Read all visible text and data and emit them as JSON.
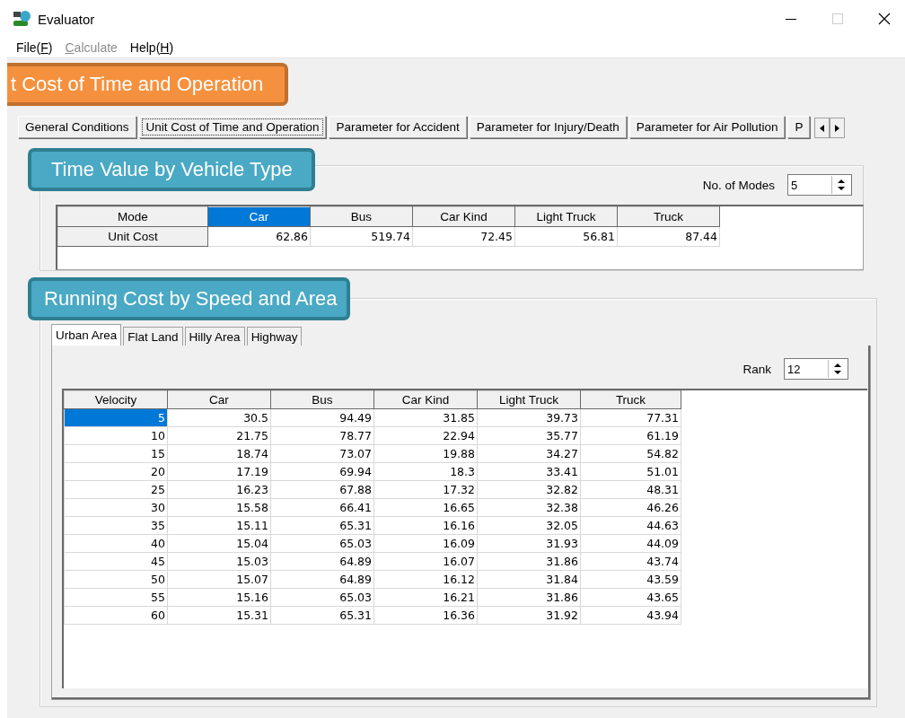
{
  "window": {
    "title": "Evaluator"
  },
  "menu": [
    {
      "before": "File(",
      "key": "F",
      "after": ")",
      "disabled": false
    },
    {
      "key": "C",
      "after": "alculate",
      "disabled": true
    },
    {
      "before": "Help(",
      "key": "H",
      "after": ")",
      "disabled": false
    }
  ],
  "callouts": [
    {
      "kind": "orange",
      "text": "t Cost of Time and Operation"
    },
    {
      "kind": "teal",
      "text": "Time Value by Vehicle Type"
    },
    {
      "kind": "teal",
      "text": "Running Cost by Speed and Area"
    }
  ],
  "tabs": [
    {
      "label": "General Conditions",
      "selected": false
    },
    {
      "label": "Unit Cost of Time and Operation",
      "selected": true
    },
    {
      "label": "Parameter for Accident",
      "selected": false
    },
    {
      "label": "Parameter for Injury/Death",
      "selected": false
    },
    {
      "label": "Parameter for Air Pollution",
      "selected": false
    },
    {
      "label": "P",
      "selected": false
    }
  ],
  "time_value": {
    "count_label": "No. of Modes",
    "count": "5",
    "row_headers": [
      "Mode",
      "Unit Cost"
    ],
    "modes": [
      {
        "name": "Car",
        "cost": "62.86",
        "selected": true
      },
      {
        "name": "Bus",
        "cost": "519.74",
        "selected": false
      },
      {
        "name": "Car Kind",
        "cost": "72.45",
        "selected": false
      },
      {
        "name": "Light Truck",
        "cost": "56.81",
        "selected": false
      },
      {
        "name": "Truck",
        "cost": "87.44",
        "selected": false
      }
    ]
  },
  "running_cost": {
    "tabs": [
      {
        "label": "Urban Area",
        "selected": true
      },
      {
        "label": "Flat Land",
        "selected": false
      },
      {
        "label": "Hilly Area",
        "selected": false
      },
      {
        "label": "Highway",
        "selected": false
      }
    ],
    "rank_label": "Rank",
    "rank": "12",
    "columns": [
      "Velocity",
      "Car",
      "Bus",
      "Car Kind",
      "Light Truck",
      "Truck"
    ],
    "rows": [
      {
        "cells": [
          "5",
          "30.5",
          "94.49",
          "31.85",
          "39.73",
          "77.31"
        ],
        "selected": true
      },
      {
        "cells": [
          "10",
          "21.75",
          "78.77",
          "22.94",
          "35.77",
          "61.19"
        ],
        "selected": false
      },
      {
        "cells": [
          "15",
          "18.74",
          "73.07",
          "19.88",
          "34.27",
          "54.82"
        ],
        "selected": false
      },
      {
        "cells": [
          "20",
          "17.19",
          "69.94",
          "18.3",
          "33.41",
          "51.01"
        ],
        "selected": false
      },
      {
        "cells": [
          "25",
          "16.23",
          "67.88",
          "17.32",
          "32.82",
          "48.31"
        ],
        "selected": false
      },
      {
        "cells": [
          "30",
          "15.58",
          "66.41",
          "16.65",
          "32.38",
          "46.26"
        ],
        "selected": false
      },
      {
        "cells": [
          "35",
          "15.11",
          "65.31",
          "16.16",
          "32.05",
          "44.63"
        ],
        "selected": false
      },
      {
        "cells": [
          "40",
          "15.04",
          "65.03",
          "16.09",
          "31.93",
          "44.09"
        ],
        "selected": false
      },
      {
        "cells": [
          "45",
          "15.03",
          "64.89",
          "16.07",
          "31.86",
          "43.74"
        ],
        "selected": false
      },
      {
        "cells": [
          "50",
          "15.07",
          "64.89",
          "16.12",
          "31.84",
          "43.59"
        ],
        "selected": false
      },
      {
        "cells": [
          "55",
          "15.16",
          "65.03",
          "16.21",
          "31.86",
          "43.65"
        ],
        "selected": false
      },
      {
        "cells": [
          "60",
          "15.31",
          "65.31",
          "16.36",
          "31.92",
          "43.94"
        ],
        "selected": false
      }
    ]
  }
}
